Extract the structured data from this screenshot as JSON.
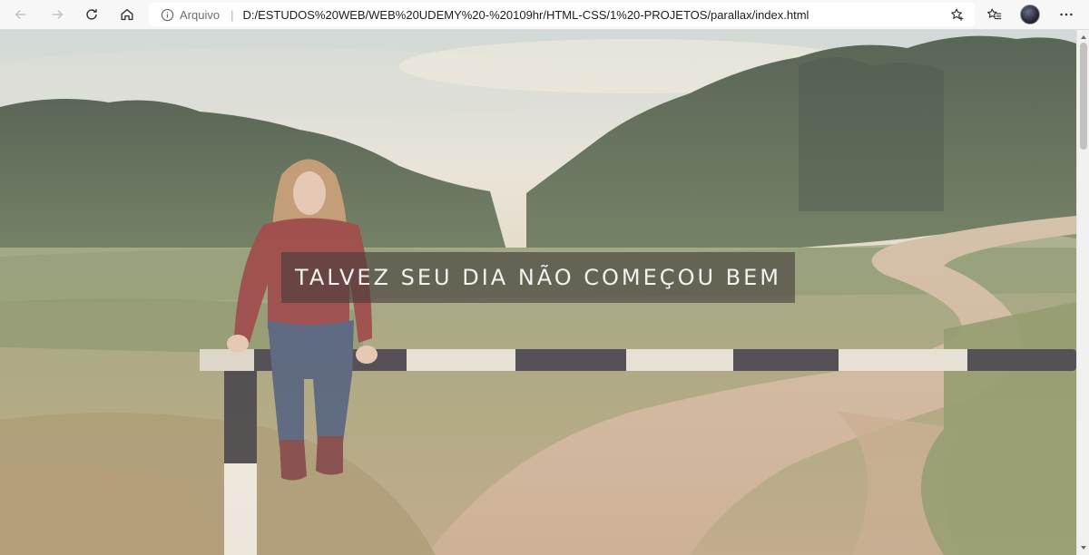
{
  "browser": {
    "site_info_label": "Arquivo",
    "url": "D:/ESTUDOS%20WEB/WEB%20UDEMY%20-%20109hr/HTML-CSS/1%20-PROJETOS/parallax/index.html",
    "icons": [
      "back-icon",
      "forward-icon",
      "refresh-icon",
      "home-icon",
      "info-icon",
      "add-favorite-icon",
      "favorites-icon",
      "profile-avatar",
      "more-icon"
    ]
  },
  "page": {
    "headline": "TALVEZ SEU DIA NÃO COMEÇOU BEM",
    "hero_image": "girl-sitting-on-barrier-by-dirt-road"
  },
  "colors": {
    "headline_bg": "#463e3c",
    "headline_text": "#f3f0ee",
    "toolbar_bg": "#f7f7f7"
  }
}
